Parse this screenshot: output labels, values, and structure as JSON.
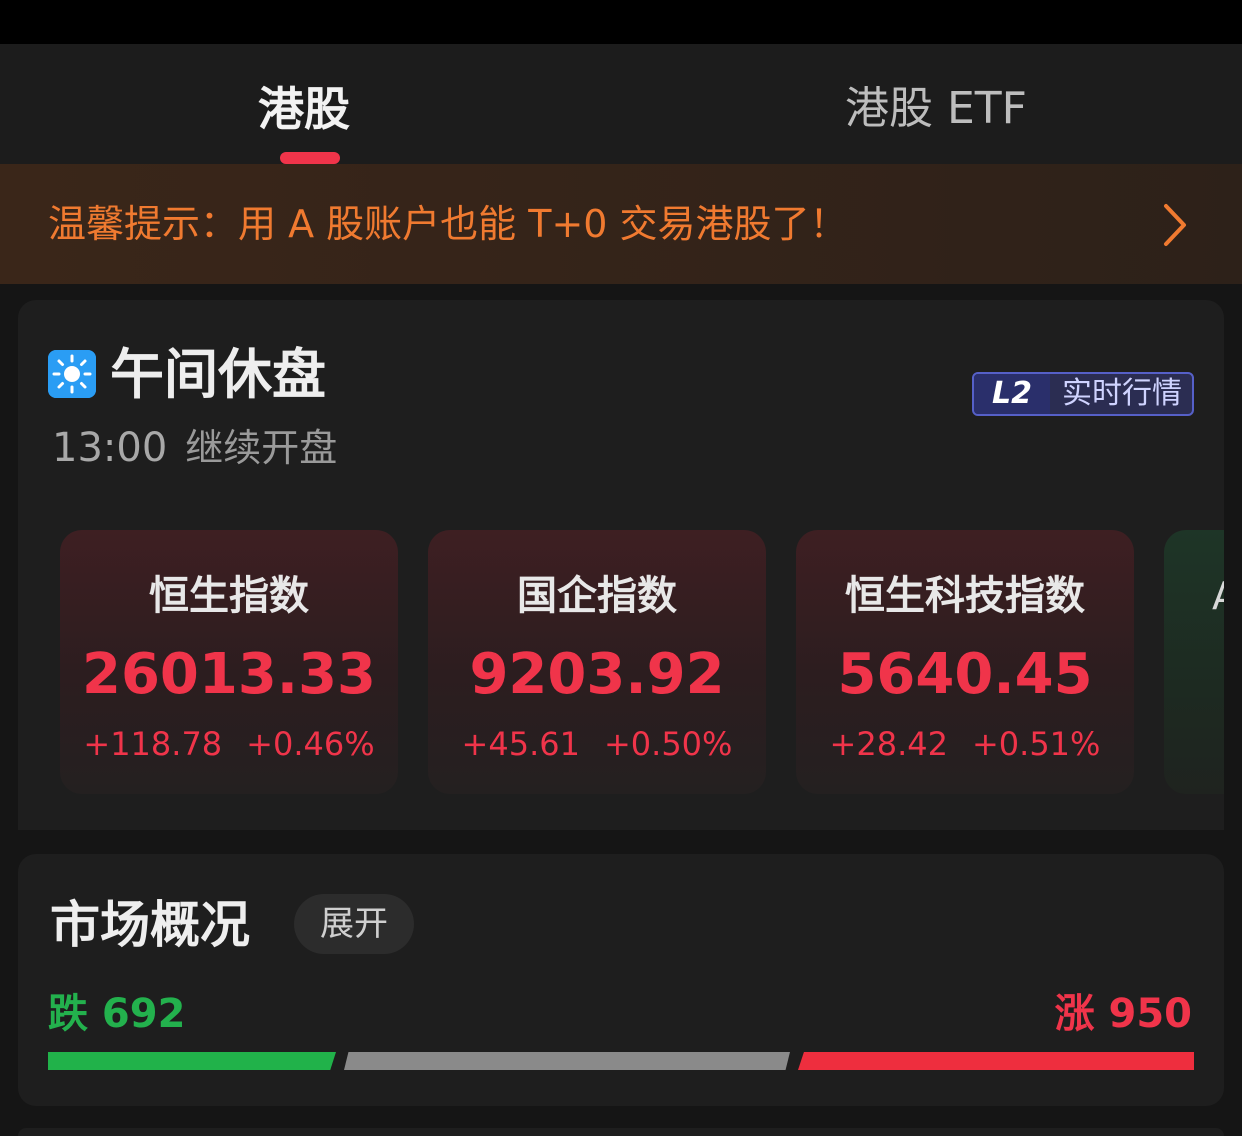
{
  "tabs": [
    {
      "label": "港股",
      "active": true
    },
    {
      "label": "港股 ETF",
      "active": false
    }
  ],
  "notice": {
    "text": "温馨提示：用 A 股账户也能 T+0 交易港股了！",
    "arrow_icon": "chevron-right-icon"
  },
  "session": {
    "icon": "sun-icon",
    "title": "午间休盘",
    "resume_time": "13:00",
    "resume_text": "继续开盘",
    "badge_mark": "L2",
    "badge_text": "实时行情"
  },
  "indices": [
    {
      "name": "恒生指数",
      "value": "26013.33",
      "change": "+118.78",
      "change_pct": "+0.46%"
    },
    {
      "name": "国企指数",
      "value": "9203.92",
      "change": "+45.61",
      "change_pct": "+0.50%"
    },
    {
      "name": "恒生科技指数",
      "value": "5640.45",
      "change": "+28.42",
      "change_pct": "+0.51%"
    }
  ],
  "indices_peek_label": "A",
  "overview": {
    "title": "市场概况",
    "expand_label": "展开",
    "down_label": "跌 692",
    "up_label": "涨 950",
    "down_count": 692,
    "up_count": 950
  },
  "colors": {
    "up": "#f0344a",
    "down": "#23b14d",
    "notice_text": "#f07a30",
    "accent": "#f0344a"
  }
}
